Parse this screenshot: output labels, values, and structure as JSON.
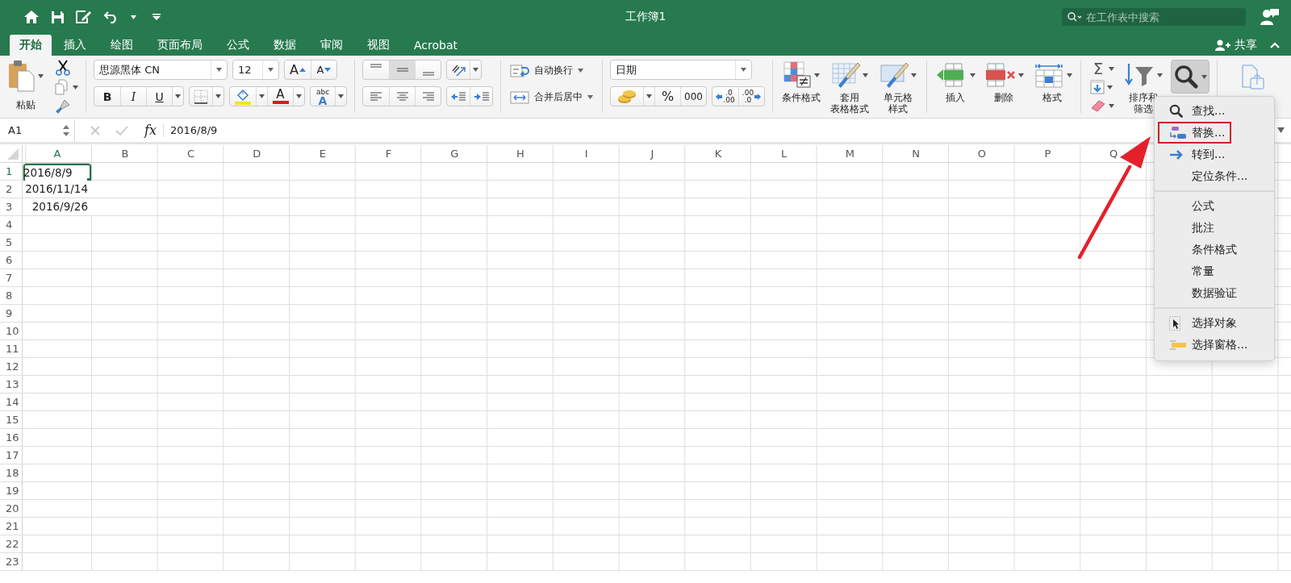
{
  "window": {
    "title": "工作簿1"
  },
  "search": {
    "placeholder": "在工作表中搜索"
  },
  "tabs": [
    {
      "label": "开始",
      "selected": true
    },
    {
      "label": "插入",
      "selected": false
    },
    {
      "label": "绘图",
      "selected": false
    },
    {
      "label": "页面布局",
      "selected": false
    },
    {
      "label": "公式",
      "selected": false
    },
    {
      "label": "数据",
      "selected": false
    },
    {
      "label": "审阅",
      "selected": false
    },
    {
      "label": "视图",
      "selected": false
    },
    {
      "label": "Acrobat",
      "selected": false
    }
  ],
  "share": {
    "label": "共享"
  },
  "ribbon": {
    "paste": {
      "label": "粘贴"
    },
    "font": {
      "name": "思源黑体 CN",
      "size": "12",
      "grow": "A",
      "shrink": "A",
      "bold": "B",
      "italic": "I",
      "underline": "U",
      "font_color": "A",
      "phonetic": [
        "abc",
        "A"
      ]
    },
    "vertical_align": [
      {
        "selected": false
      },
      {
        "selected": true
      },
      {
        "selected": false
      }
    ],
    "alignment": {
      "wrap_text": "自动换行",
      "merge_center": "合并后居中"
    },
    "number": {
      "format": "日期",
      "percent": "%",
      "thousands": "000",
      "increase_decimal": [
        ".0",
        ".00"
      ],
      "decrease_decimal": [
        ".00",
        ".0"
      ]
    },
    "styles": [
      {
        "lines": [
          "条件格式"
        ]
      },
      {
        "lines": [
          "套用",
          "表格格式"
        ]
      },
      {
        "lines": [
          "单元格",
          "样式"
        ]
      }
    ],
    "cells": [
      {
        "lines": [
          "插入"
        ]
      },
      {
        "lines": [
          "删除"
        ]
      },
      {
        "lines": [
          "格式"
        ]
      }
    ],
    "editing": {
      "autosum": "Σ",
      "sort_filter": [
        "排序和",
        "筛选"
      ],
      "find_pressed": true
    }
  },
  "formula_bar": {
    "name_box": "A1",
    "fx": "fx",
    "formula": "2016/8/9"
  },
  "sheet": {
    "columns": [
      {
        "label": "A",
        "selected": true
      },
      {
        "label": "B",
        "selected": false
      },
      {
        "label": "C",
        "selected": false
      },
      {
        "label": "D",
        "selected": false
      },
      {
        "label": "E",
        "selected": false
      },
      {
        "label": "F",
        "selected": false
      },
      {
        "label": "G",
        "selected": false
      },
      {
        "label": "H",
        "selected": false
      },
      {
        "label": "I",
        "selected": false
      },
      {
        "label": "J",
        "selected": false
      },
      {
        "label": "K",
        "selected": false
      },
      {
        "label": "L",
        "selected": false
      },
      {
        "label": "M",
        "selected": false
      },
      {
        "label": "N",
        "selected": false
      },
      {
        "label": "O",
        "selected": false
      },
      {
        "label": "P",
        "selected": false
      },
      {
        "label": "Q",
        "selected": false
      }
    ],
    "rows": [
      {
        "label": "1",
        "selected": true,
        "cells": [
          {
            "value": "2016/8/9",
            "selected": true
          }
        ]
      },
      {
        "label": "2",
        "selected": false,
        "cells": [
          {
            "value": "2016/11/14",
            "selected": false
          }
        ]
      },
      {
        "label": "3",
        "selected": false,
        "cells": [
          {
            "value": "2016/9/26",
            "selected": false
          }
        ]
      },
      {
        "label": "4",
        "selected": false
      },
      {
        "label": "5",
        "selected": false
      },
      {
        "label": "6",
        "selected": false
      },
      {
        "label": "7",
        "selected": false
      },
      {
        "label": "8",
        "selected": false
      },
      {
        "label": "9",
        "selected": false
      },
      {
        "label": "10",
        "selected": false
      },
      {
        "label": "11",
        "selected": false
      },
      {
        "label": "12",
        "selected": false
      },
      {
        "label": "13",
        "selected": false
      },
      {
        "label": "14",
        "selected": false
      },
      {
        "label": "15",
        "selected": false
      },
      {
        "label": "16",
        "selected": false
      },
      {
        "label": "17",
        "selected": false
      },
      {
        "label": "18",
        "selected": false
      },
      {
        "label": "19",
        "selected": false
      },
      {
        "label": "20",
        "selected": false
      },
      {
        "label": "21",
        "selected": false
      },
      {
        "label": "22",
        "selected": false
      },
      {
        "label": "23",
        "selected": false
      }
    ]
  },
  "menu": {
    "groups": [
      [
        {
          "label": "查找...",
          "highlighted": false
        },
        {
          "label": "替换...",
          "highlighted": true
        },
        {
          "label": "转到...",
          "highlighted": false
        },
        {
          "label": "定位条件...",
          "highlighted": false
        }
      ],
      [
        {
          "label": "公式",
          "highlighted": false
        },
        {
          "label": "批注",
          "highlighted": false
        },
        {
          "label": "条件格式",
          "highlighted": false
        },
        {
          "label": "常量",
          "highlighted": false
        },
        {
          "label": "数据验证",
          "highlighted": false
        }
      ],
      [
        {
          "label": "选择对象",
          "highlighted": false
        },
        {
          "label": "选择窗格...",
          "highlighted": false
        }
      ]
    ]
  }
}
